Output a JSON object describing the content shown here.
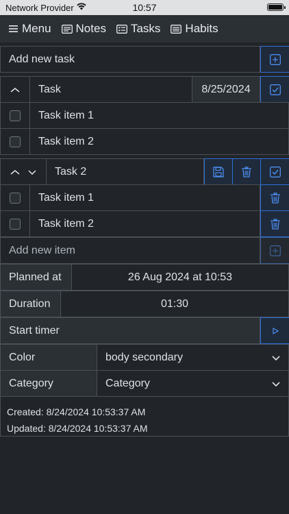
{
  "status_bar": {
    "carrier": "Network Provider",
    "time": "10:57",
    "icons": [
      "wifi-icon",
      "battery-icon"
    ]
  },
  "nav": {
    "menu": "Menu",
    "notes": "Notes",
    "tasks": "Tasks",
    "habits": "Habits"
  },
  "new_task": {
    "placeholder": "Add new task"
  },
  "task1": {
    "title": "Task",
    "date": "8/25/2024",
    "items": [
      {
        "label": "Task item 1"
      },
      {
        "label": "Task item 2"
      }
    ]
  },
  "task2": {
    "title": "Task 2",
    "items": [
      {
        "label": "Task item 1"
      },
      {
        "label": "Task item 2"
      }
    ],
    "new_item_placeholder": "Add new item",
    "planned_label": "Planned at",
    "planned_value": "26 Aug 2024 at 10:53",
    "duration_label": "Duration",
    "duration_value": "01:30",
    "start_timer": "Start timer",
    "color_label": "Color",
    "color_value": "body secondary",
    "category_label": "Category",
    "category_value": "Category",
    "created": "Created: 8/24/2024 10:53:37 AM",
    "updated": "Updated: 8/24/2024 10:53:37 AM"
  },
  "colors": {
    "background": "#212529",
    "accent": "#2f6fd6",
    "border": "#495057"
  }
}
